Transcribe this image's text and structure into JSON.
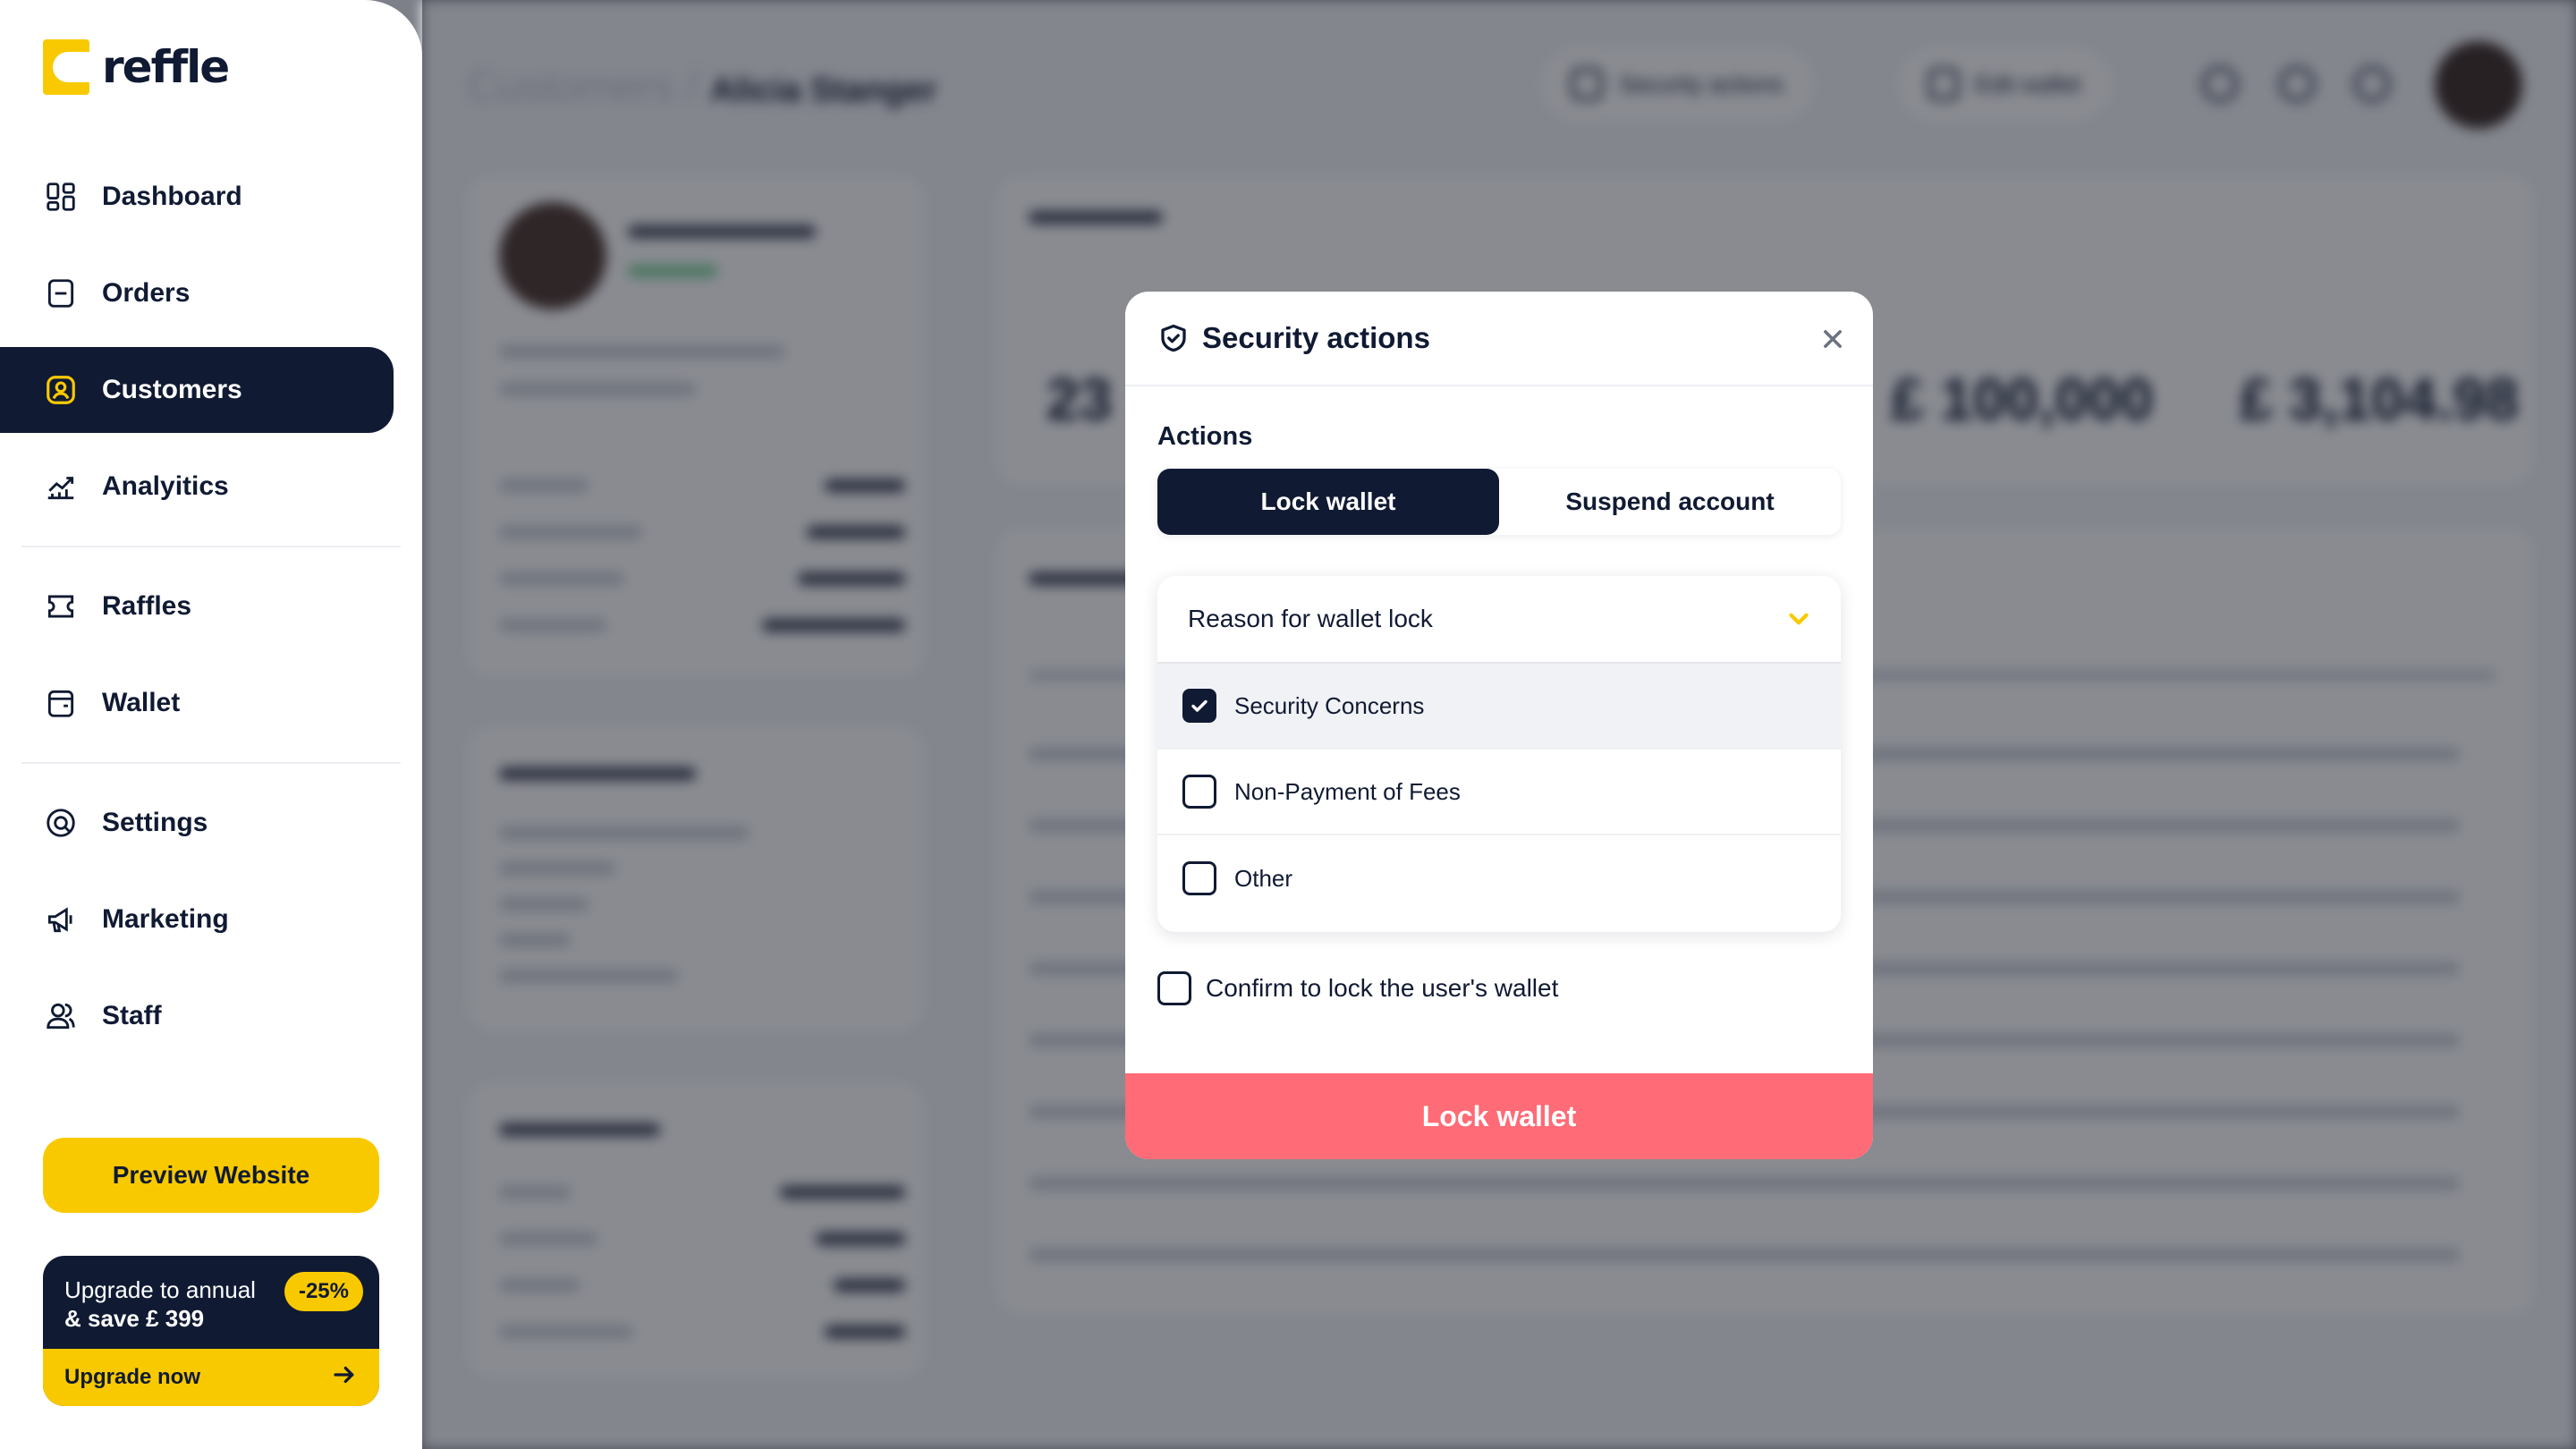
{
  "app": {
    "logo_text": "reffle",
    "brand_color": "#f9c900",
    "dark_color": "#101a33"
  },
  "sidebar": {
    "items": [
      {
        "label": "Dashboard",
        "icon": "dashboard-icon"
      },
      {
        "label": "Orders",
        "icon": "orders-icon"
      },
      {
        "label": "Customers",
        "icon": "customers-icon",
        "active": true
      },
      {
        "label": "Analyitics",
        "icon": "analytics-icon"
      },
      {
        "label": "Raffles",
        "icon": "ticket-icon"
      },
      {
        "label": "Wallet",
        "icon": "wallet-icon"
      },
      {
        "label": "Settings",
        "icon": "settings-icon"
      },
      {
        "label": "Marketing",
        "icon": "megaphone-icon"
      },
      {
        "label": "Staff",
        "icon": "staff-icon"
      }
    ],
    "preview_label": "Preview Website",
    "upgrade": {
      "line1": "Upgrade to annual",
      "line2": "& save £ 399",
      "badge": "-25%",
      "cta": "Upgrade now"
    }
  },
  "modal": {
    "title": "Security actions",
    "section_label": "Actions",
    "tabs": [
      "Lock wallet",
      "Suspend account"
    ],
    "active_tab": "Lock wallet",
    "dropdown": {
      "placeholder": "Reason for wallet lock",
      "options": [
        {
          "label": "Security Concerns",
          "checked": true
        },
        {
          "label": "Non-Payment of Fees",
          "checked": false
        },
        {
          "label": "Other",
          "checked": false
        }
      ]
    },
    "confirm_label": "Confirm to lock the user's wallet",
    "confirm_checked": false,
    "submit_label": "Lock wallet",
    "submit_color": "#ff6b76"
  },
  "background": {
    "breadcrumb_root": "Customers /",
    "breadcrumb_current": "Alicia Stanger",
    "top_actions": [
      "Security actions",
      "Edit wallet"
    ],
    "stat_values": [
      "23",
      "£ 100,000",
      "£ 3,104.98"
    ]
  }
}
